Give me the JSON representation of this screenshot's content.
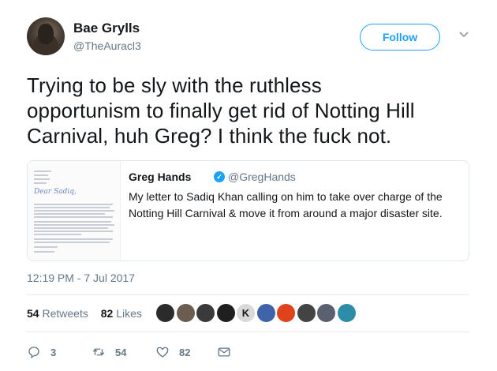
{
  "author": {
    "name": "Bae Grylls",
    "handle": "@TheAuracl3"
  },
  "follow_label": "Follow",
  "tweet": {
    "line1": "Trying to be sly with the ruthless",
    "line2": "opportunism to finally get rid of Notting Hill",
    "line3": "Carnival, huh Greg? I think the fuck not."
  },
  "quoted": {
    "name": "Greg Hands",
    "handle": "@GregHands",
    "line1": "My letter to Sadiq Khan calling on him to take over charge of the",
    "line2": "Notting Hill Carnival & move it from around a major disaster site.",
    "letter_salutation": "Dear Sadiq,"
  },
  "timestamp": "12:19 PM - 7 Jul 2017",
  "stats": {
    "retweets_count": "54",
    "retweets_label": "Retweets",
    "likes_count": "82",
    "likes_label": "Likes"
  },
  "likers": [
    {
      "color": "#2b2b2b"
    },
    {
      "color": "#6b5d50"
    },
    {
      "color": "#3a3a3a"
    },
    {
      "color": "#1f1f1f"
    },
    {
      "color": "#d9d9d9",
      "letter": "K"
    },
    {
      "color": "#3f63a8"
    },
    {
      "color": "#e0421b"
    },
    {
      "color": "#444444"
    },
    {
      "color": "#5a6070"
    },
    {
      "color": "#2d8ca8"
    }
  ],
  "actions": {
    "reply_count": "3",
    "retweet_count": "54",
    "like_count": "82"
  },
  "colors": {
    "accent": "#1da1f2",
    "muted": "#657786",
    "text": "#14171a",
    "border": "#e1e8ed"
  }
}
